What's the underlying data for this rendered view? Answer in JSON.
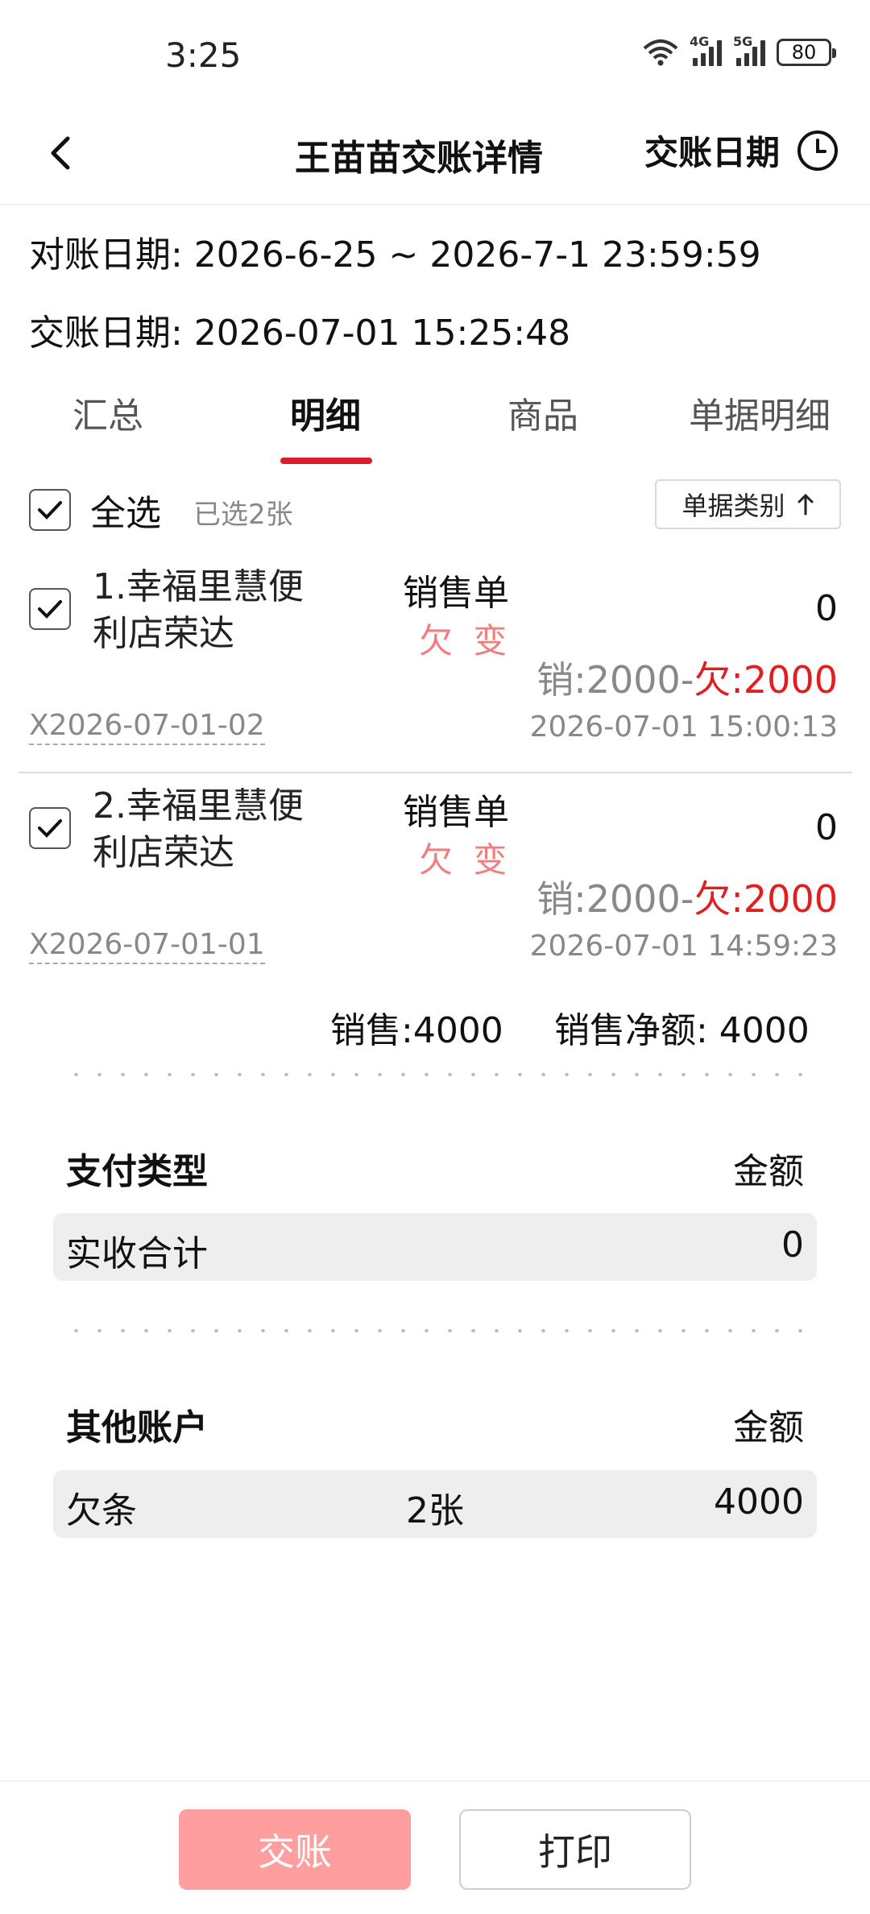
{
  "status_bar": {
    "time": "3:25",
    "signal1_label": "4G",
    "signal2_label": "5G",
    "battery": "80"
  },
  "header": {
    "title": "王苗苗交账详情",
    "date_button": "交账日期"
  },
  "info": {
    "reconcile": "对账日期: 2026-6-25 ~ 2026-7-1 23:59:59",
    "handover": "交账日期: 2026-07-01 15:25:48"
  },
  "tabs": [
    {
      "label": "汇总"
    },
    {
      "label": "明细",
      "active": true
    },
    {
      "label": "商品"
    },
    {
      "label": "单据明细"
    }
  ],
  "select_all": {
    "label": "全选",
    "selected_count": "已选2张",
    "sort_label": "单据类别"
  },
  "records": [
    {
      "name": "1.幸福里慧便利店荣达",
      "type": "销售单",
      "tag": "欠 变",
      "amount": "0",
      "balance_sale": "销:2000-",
      "balance_debt": "欠:2000",
      "doc_no": "X2026-07-01-02",
      "time": "2026-07-01 15:00:13",
      "checked": true
    },
    {
      "name": "2.幸福里慧便利店荣达",
      "type": "销售单",
      "tag": "欠 变",
      "amount": "0",
      "balance_sale": "销:2000-",
      "balance_debt": "欠:2000",
      "doc_no": "X2026-07-01-01",
      "time": "2026-07-01 14:59:23",
      "checked": true
    }
  ],
  "totals": {
    "sales": "销售:4000",
    "net_sales": "销售净额: 4000"
  },
  "payment": {
    "heading": "支付类型",
    "amount_heading": "金额",
    "row": {
      "label": "实收合计",
      "amount": "0"
    }
  },
  "other_accounts": {
    "heading": "其他账户",
    "amount_heading": "金额",
    "row": {
      "label": "欠条",
      "count": "2张",
      "amount": "4000"
    }
  },
  "buttons": {
    "settle": "交账",
    "print": "打印"
  },
  "colors": {
    "accent": "#d81e2c",
    "debt_red": "#e02020",
    "tag_red": "#f37c7c",
    "settle_button": "#ff9e9e"
  }
}
